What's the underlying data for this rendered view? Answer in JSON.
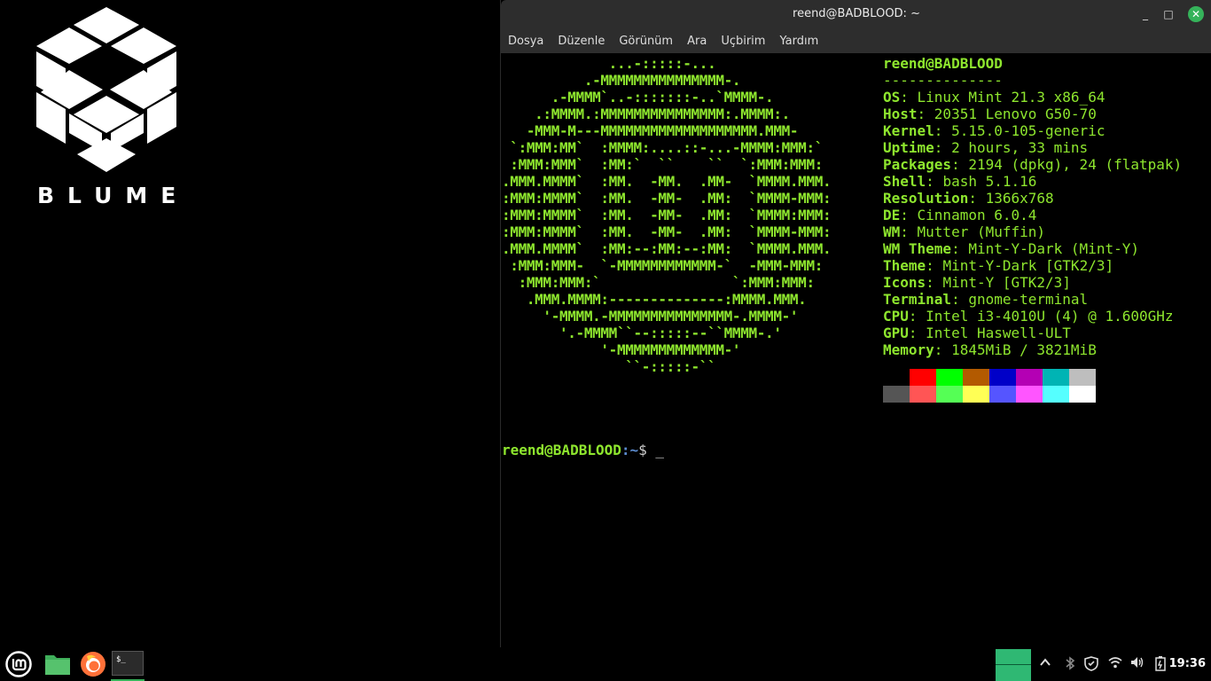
{
  "desktop": {
    "logo_text": "BLUME"
  },
  "window": {
    "title": "reend@BADBLOOD: ~",
    "controls": {
      "minimize": "_",
      "maximize": "□",
      "close": "✕"
    },
    "menu": [
      "Dosya",
      "Düzenle",
      "Görünüm",
      "Ara",
      "Uçbirim",
      "Yardım"
    ]
  },
  "terminal": {
    "ascii_logo": "             ...-:::::-...\n          .-MMMMMMMMMMMMMMM-.\n      .-MMMM`..-:::::::-..`MMMM-.\n    .:MMMM.:MMMMMMMMMMMMMMM:.MMMM:.\n   -MMM-M---MMMMMMMMMMMMMMMMMMM.MMM-\n `:MMM:MM`  :MMMM:....::-...-MMMM:MMM:`\n :MMM:MMM`  :MM:`  ``    ``  `:MMM:MMM:\n.MMM.MMMM`  :MM.  -MM.  .MM-  `MMMM.MMM.\n:MMM:MMMM`  :MM.  -MM-  .MM:  `MMMM-MMM:\n:MMM:MMMM`  :MM.  -MM-  .MM:  `MMMM:MMM:\n:MMM:MMMM`  :MM.  -MM-  .MM:  `MMMM-MMM:\n.MMM.MMMM`  :MM:--:MM:--:MM:  `MMMM.MMM.\n :MMM:MMM-  `-MMMMMMMMMMMM-`  -MMM-MMM:\n  :MMM:MMM:`                `:MMM:MMM:\n   .MMM.MMMM:--------------:MMMM.MMM.\n     '-MMMM.-MMMMMMMMMMMMMMM-.MMMM-'\n       '.-MMMM``--:::::--``MMMM-.'\n            '-MMMMMMMMMMMMM-'\n               ``-:::::-``",
    "user_host": "reend@BADBLOOD",
    "separator": "--------------",
    "info": [
      {
        "key": "OS",
        "value": "Linux Mint 21.3 x86_64"
      },
      {
        "key": "Host",
        "value": "20351 Lenovo G50-70"
      },
      {
        "key": "Kernel",
        "value": "5.15.0-105-generic"
      },
      {
        "key": "Uptime",
        "value": "2 hours, 33 mins"
      },
      {
        "key": "Packages",
        "value": "2194 (dpkg), 24 (flatpak)"
      },
      {
        "key": "Shell",
        "value": "bash 5.1.16"
      },
      {
        "key": "Resolution",
        "value": "1366x768"
      },
      {
        "key": "DE",
        "value": "Cinnamon 6.0.4"
      },
      {
        "key": "WM",
        "value": "Mutter (Muffin)"
      },
      {
        "key": "WM Theme",
        "value": "Mint-Y-Dark (Mint-Y)"
      },
      {
        "key": "Theme",
        "value": "Mint-Y-Dark [GTK2/3]"
      },
      {
        "key": "Icons",
        "value": "Mint-Y [GTK2/3]"
      },
      {
        "key": "Terminal",
        "value": "gnome-terminal"
      },
      {
        "key": "CPU",
        "value": "Intel i3-4010U (4) @ 1.600GHz"
      },
      {
        "key": "GPU",
        "value": "Intel Haswell-ULT"
      },
      {
        "key": "Memory",
        "value": "1845MiB / 3821MiB"
      }
    ],
    "palette_row1": [
      "#000000",
      "#ff0000",
      "#00ff00",
      "#b35a00",
      "#0000c8",
      "#b400b4",
      "#00b4b4",
      "#bebebe"
    ],
    "palette_row2": [
      "#555555",
      "#ff5555",
      "#55ff55",
      "#ffff55",
      "#5555ff",
      "#ff55ff",
      "#55ffff",
      "#ffffff"
    ],
    "prompt": {
      "user": "reend@BADBLOOD",
      "path": ":~",
      "symbol": "$ ",
      "cursor": "_"
    }
  },
  "taskbar": {
    "clock": "19:36",
    "accent_color": "#35b35a"
  }
}
